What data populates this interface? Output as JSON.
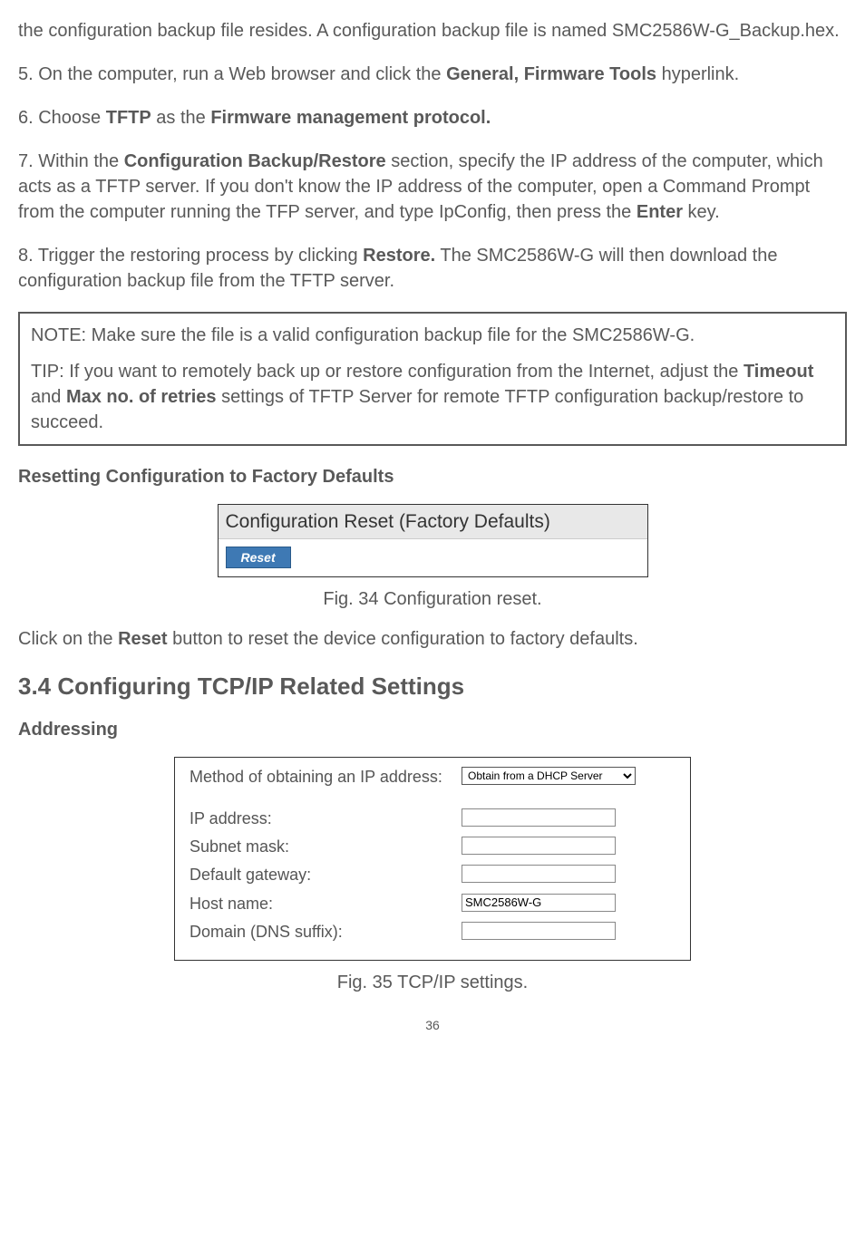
{
  "paragraphs": {
    "p1": "the configuration backup file resides. A configuration backup file is named SMC2586W-G_Backup.hex.",
    "p2_pre": "5. On the computer, run a Web browser and click the ",
    "p2_bold": "General, Firmware Tools",
    "p2_post": " hyperlink.",
    "p3_pre": "6. Choose ",
    "p3_bold1": "TFTP",
    "p3_mid": " as the ",
    "p3_bold2": "Firmware management protocol.",
    "p4_pre": "7. Within the ",
    "p4_bold1": "Configuration Backup/Restore",
    "p4_mid": " section, specify the IP address of the computer, which acts as a TFTP server. If you don't know the IP address of the computer, open a Command Prompt from the computer running the TFP server, and type IpConfig, then press the ",
    "p4_bold2": "Enter",
    "p4_post": " key.",
    "p5_pre": "8. Trigger the restoring process by clicking ",
    "p5_bold": "Restore.",
    "p5_post": " The SMC2586W-G will then download the configuration backup file from the TFTP server.",
    "note1": "NOTE: Make sure the file is a valid configuration backup file for the SMC2586W-G.",
    "tip_pre": "TIP: If you want to remotely back up or restore configuration from the Internet, adjust the ",
    "tip_bold1": "Timeout",
    "tip_mid1": " and ",
    "tip_bold2": "Max no. of retries",
    "tip_post": " settings of TFTP Server for remote TFTP configuration backup/restore to succeed.",
    "h3_reset": "Resetting Configuration to Factory Defaults",
    "fig34_title": "Configuration Reset (Factory Defaults)",
    "fig34_button": "Reset",
    "fig34_caption": "Fig. 34 Configuration reset.",
    "p_click_pre": "Click on the ",
    "p_click_bold": "Reset",
    "p_click_post": " button to reset the device configuration to factory defaults.",
    "h2_section": "3.4 Configuring TCP/IP Related Settings",
    "h3_addressing": "Addressing",
    "fig35_caption": "Fig. 35 TCP/IP settings."
  },
  "tcpip": {
    "labels": {
      "method": "Method of obtaining an IP address:",
      "ip": "IP address:",
      "subnet": "Subnet mask:",
      "gateway": "Default gateway:",
      "host": "Host name:",
      "domain": "Domain (DNS suffix):"
    },
    "values": {
      "method_option": "Obtain from a DHCP Server",
      "ip": "",
      "subnet": "",
      "gateway": "",
      "host": "SMC2586W-G",
      "domain": ""
    }
  },
  "page_number": "36"
}
